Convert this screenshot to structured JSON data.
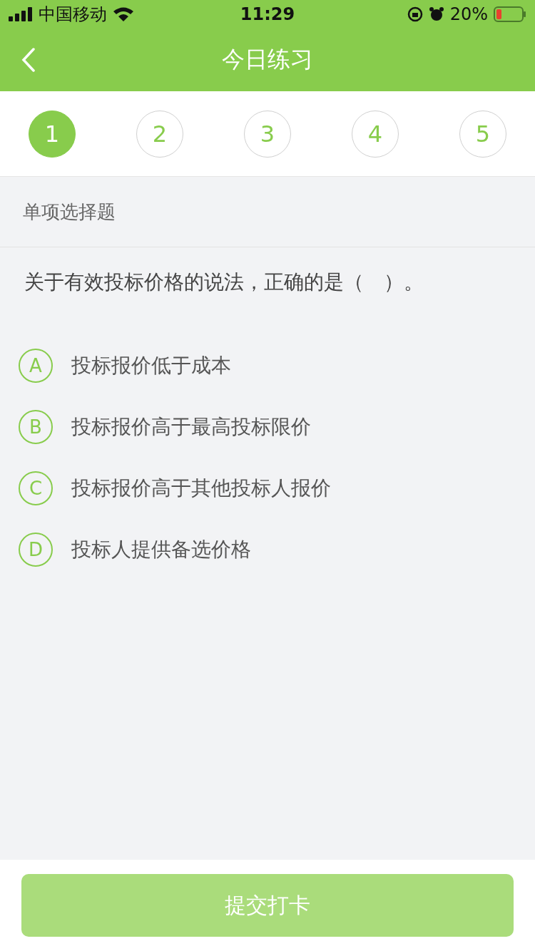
{
  "status_bar": {
    "carrier": "中国移动",
    "time": "11:29",
    "battery": "20%"
  },
  "nav": {
    "title": "今日练习"
  },
  "steps": [
    {
      "label": "1",
      "selected": true
    },
    {
      "label": "2",
      "selected": false
    },
    {
      "label": "3",
      "selected": false
    },
    {
      "label": "4",
      "selected": false
    },
    {
      "label": "5",
      "selected": false
    }
  ],
  "section": {
    "title": "单项选择题"
  },
  "question": {
    "text": "关于有效投标价格的说法，正确的是（　）。"
  },
  "options": [
    {
      "letter": "A",
      "text": "投标报价低于成本",
      "selected": false
    },
    {
      "letter": "B",
      "text": "投标报价高于最高投标限价",
      "selected": false
    },
    {
      "letter": "C",
      "text": "投标报价高于其他投标人报价",
      "selected": false
    },
    {
      "letter": "D",
      "text": "投标人提供备选价格",
      "selected": false
    }
  ],
  "submit": {
    "label": "提交打卡",
    "disabled": true
  }
}
